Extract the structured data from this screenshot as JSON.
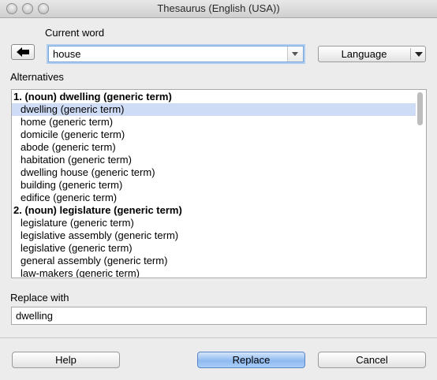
{
  "window": {
    "title": "Thesaurus (English (USA))"
  },
  "current_word": {
    "label": "Current word",
    "value": "house"
  },
  "language_button": {
    "label": "Language"
  },
  "alternatives": {
    "label": "Alternatives",
    "rows": [
      {
        "text": "1. (noun) dwelling (generic term)",
        "heading": true,
        "selected": false
      },
      {
        "text": "dwelling (generic term)",
        "heading": false,
        "selected": true
      },
      {
        "text": "home (generic term)",
        "heading": false,
        "selected": false
      },
      {
        "text": "domicile (generic term)",
        "heading": false,
        "selected": false
      },
      {
        "text": "abode (generic term)",
        "heading": false,
        "selected": false
      },
      {
        "text": "habitation (generic term)",
        "heading": false,
        "selected": false
      },
      {
        "text": "dwelling house (generic term)",
        "heading": false,
        "selected": false
      },
      {
        "text": "building (generic term)",
        "heading": false,
        "selected": false
      },
      {
        "text": "edifice (generic term)",
        "heading": false,
        "selected": false
      },
      {
        "text": "2. (noun) legislature (generic term)",
        "heading": true,
        "selected": false
      },
      {
        "text": "legislature (generic term)",
        "heading": false,
        "selected": false
      },
      {
        "text": "legislative assembly (generic term)",
        "heading": false,
        "selected": false
      },
      {
        "text": "legislative (generic term)",
        "heading": false,
        "selected": false
      },
      {
        "text": "general assembly (generic term)",
        "heading": false,
        "selected": false
      },
      {
        "text": "law-makers (generic term)",
        "heading": false,
        "selected": false
      }
    ]
  },
  "replace_with": {
    "label": "Replace with",
    "value": "dwelling"
  },
  "buttons": {
    "help": "Help",
    "replace": "Replace",
    "cancel": "Cancel"
  },
  "colors": {
    "selection": "#cfdcf6",
    "default_button": "#8fbaf0",
    "focus_ring": "#aecbf0"
  },
  "icons": {
    "back": "left-arrow-icon",
    "combo": "chevron-down-icon",
    "language": "triangle-down-icon"
  }
}
